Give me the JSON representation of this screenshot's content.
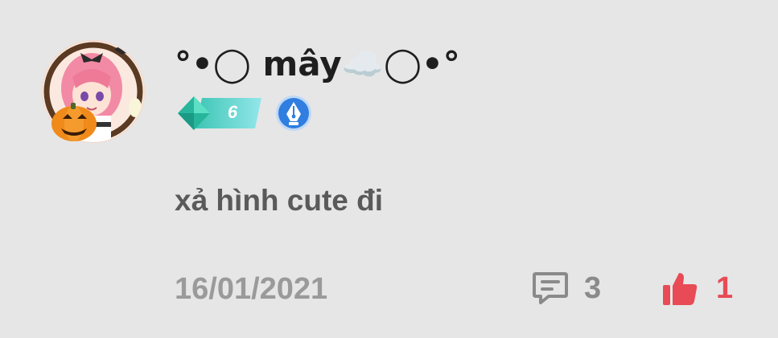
{
  "post": {
    "author": {
      "username": "°•◯ mây☁️◯•°",
      "level": "6"
    },
    "message": "xả hình cute đi",
    "date": "16/01/2021",
    "comments": {
      "count": "3"
    },
    "likes": {
      "count": "1"
    }
  },
  "colors": {
    "background": "#e6e6e6",
    "level_badge": "#4fd0c6",
    "pen_badge": "#2f7ee0",
    "like_red": "#e84b55",
    "muted_gray": "#8a8a8a"
  },
  "icons": {
    "avatar": "avatar-image",
    "level": "diamond-level-icon",
    "pen": "pen-nib-badge-icon",
    "comment": "comment-icon",
    "like": "thumbs-up-icon"
  }
}
